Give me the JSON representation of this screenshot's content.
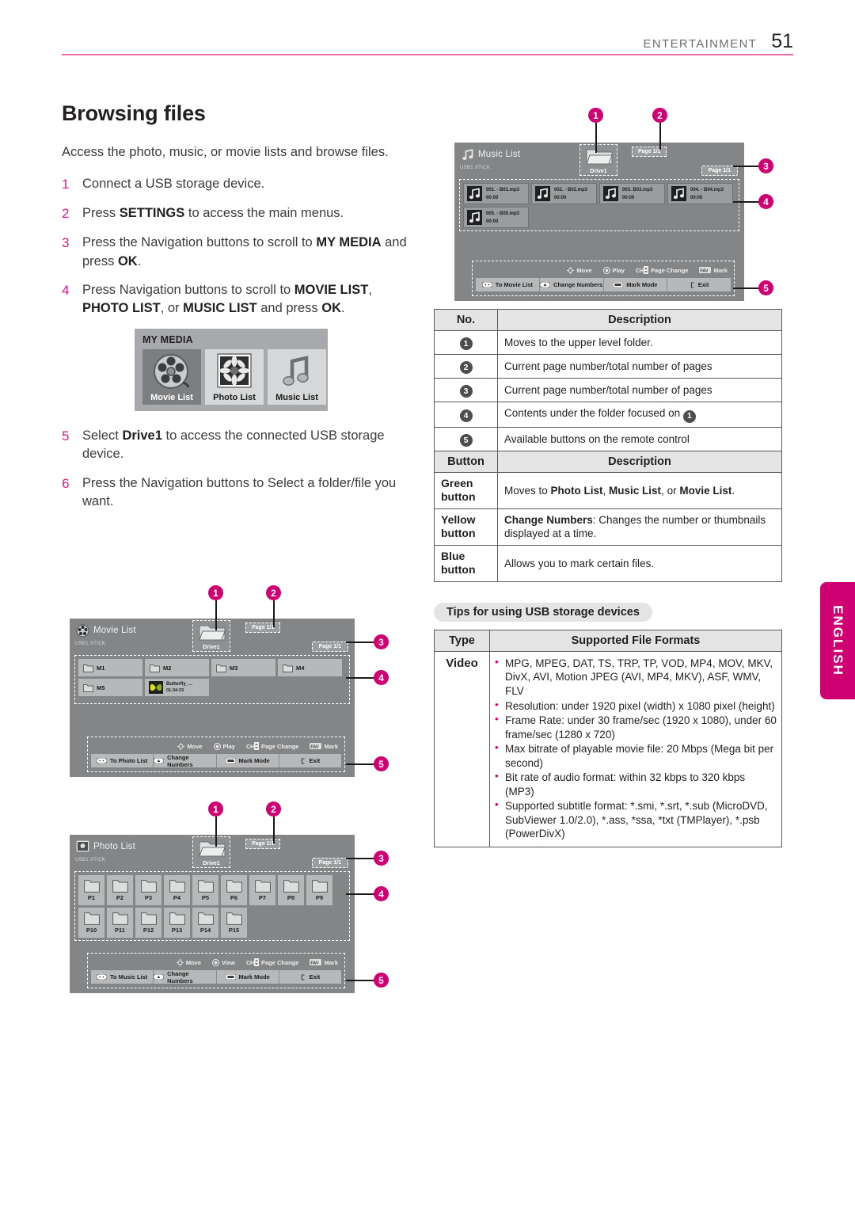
{
  "header": {
    "chapter": "ENTERTAINMENT",
    "page_number": "51"
  },
  "section": {
    "title": "Browsing files",
    "lede": "Access the photo, music, or movie lists and browse files.",
    "steps": [
      {
        "num": "1",
        "html": "Connect a USB storage device."
      },
      {
        "num": "2",
        "html": "Press <b>SETTINGS</b> to access the main menus."
      },
      {
        "num": "3",
        "html": "Press the Navigation buttons to scroll to <b>MY MEDIA</b> and press <b>OK</b>."
      },
      {
        "num": "4",
        "html": "Press Navigation buttons to scroll to <b>MOVIE LIST</b>, <b>PHOTO LIST</b>, or <b>MUSIC LIST</b> and press <b>OK</b>."
      },
      {
        "num": "5",
        "html": "Select <b>Drive1</b> to access the connected USB storage device."
      },
      {
        "num": "6",
        "html": "Press the Navigation buttons to Select a folder/file you want."
      }
    ]
  },
  "mymedia": {
    "title": "MY MEDIA",
    "tiles": [
      {
        "label": "Movie List",
        "icon": "film-reel-icon",
        "selected": true
      },
      {
        "label": "Photo List",
        "icon": "flower-photo-icon",
        "selected": false
      },
      {
        "label": "Music List",
        "icon": "music-note-icon",
        "selected": false
      }
    ]
  },
  "callouts": [
    "1",
    "2",
    "3",
    "4",
    "5"
  ],
  "screens": {
    "movie_list": {
      "title": "Movie List",
      "device": "USB1 XTICK",
      "drive_label": "Drive1",
      "page_top": "Page 1/1",
      "page_right": "Page 1/1",
      "items": [
        {
          "label": "M1",
          "type": "folder"
        },
        {
          "label": "M2",
          "type": "folder"
        },
        {
          "label": "M3",
          "type": "folder"
        },
        {
          "label": "M4",
          "type": "folder"
        },
        {
          "label": "M5",
          "type": "folder"
        },
        {
          "label": "Butterfly_...",
          "time": "01:34:33",
          "type": "thumb"
        }
      ],
      "hints": [
        {
          "icon": "dpad-icon",
          "label": "Move"
        },
        {
          "icon": "ok-icon",
          "label": "Play"
        },
        {
          "icon": "ch-updown-icon",
          "label": "Page Change"
        },
        {
          "icon": "fav-icon",
          "label": "Mark"
        }
      ],
      "buttons": [
        {
          "icon": "green-key-icon",
          "label": "To Photo List"
        },
        {
          "icon": "yellow-key-icon",
          "label": "Change Numbers"
        },
        {
          "icon": "blue-key-icon",
          "label": "Mark Mode"
        },
        {
          "icon": "exit-key-icon",
          "label": "Exit"
        }
      ]
    },
    "photo_list": {
      "title": "Photo List",
      "device": "USB1 XTICK",
      "drive_label": "Drive1",
      "page_top": "Page 1/1",
      "page_right": "Page 1/1",
      "items": [
        {
          "label": "P1"
        },
        {
          "label": "P2"
        },
        {
          "label": "P3"
        },
        {
          "label": "P4"
        },
        {
          "label": "P5"
        },
        {
          "label": "P6"
        },
        {
          "label": "P7"
        },
        {
          "label": "P8"
        },
        {
          "label": "P9"
        },
        {
          "label": "P10"
        },
        {
          "label": "P11"
        },
        {
          "label": "P12"
        },
        {
          "label": "P13"
        },
        {
          "label": "P14"
        },
        {
          "label": "P15"
        }
      ],
      "hints": [
        {
          "icon": "dpad-icon",
          "label": "Move"
        },
        {
          "icon": "ok-icon",
          "label": "View"
        },
        {
          "icon": "ch-updown-icon",
          "label": "Page Change"
        },
        {
          "icon": "fav-icon",
          "label": "Mark"
        }
      ],
      "buttons": [
        {
          "icon": "green-key-icon",
          "label": "To Music List"
        },
        {
          "icon": "yellow-key-icon",
          "label": "Change Numbers"
        },
        {
          "icon": "blue-key-icon",
          "label": "Mark Mode"
        },
        {
          "icon": "exit-key-icon",
          "label": "Exit"
        }
      ]
    },
    "music_list": {
      "title": "Music List",
      "device": "USB1 XTICK",
      "drive_label": "Drive1",
      "page_top": "Page 1/1",
      "page_right": "Page 1/1",
      "items": [
        {
          "name": "001. - B01.mp3",
          "time": "00:00"
        },
        {
          "name": "002. - B02.mp3",
          "time": "00:00"
        },
        {
          "name": "003. B03.mp3",
          "time": "00:00"
        },
        {
          "name": "004. - B04.mp3",
          "time": "00:00"
        },
        {
          "name": "005. - B05.mp3",
          "time": "00:00"
        }
      ],
      "hints": [
        {
          "icon": "dpad-icon",
          "label": "Move"
        },
        {
          "icon": "ok-icon",
          "label": "Play"
        },
        {
          "icon": "ch-updown-icon",
          "label": "Page Change"
        },
        {
          "icon": "fav-icon",
          "label": "Mark"
        }
      ],
      "buttons": [
        {
          "icon": "green-key-icon",
          "label": "To Movie List"
        },
        {
          "icon": "yellow-key-icon",
          "label": "Change Numbers"
        },
        {
          "icon": "blue-key-icon",
          "label": "Mark Mode"
        },
        {
          "icon": "exit-key-icon",
          "label": "Exit"
        }
      ]
    }
  },
  "no_table": {
    "headers": [
      "No.",
      "Description"
    ],
    "rows": [
      {
        "no": "1",
        "desc": "Moves to the upper level folder."
      },
      {
        "no": "2",
        "desc": "Current page number/total number of pages"
      },
      {
        "no": "3",
        "desc": "Current page number/total number of pages"
      },
      {
        "no": "4",
        "desc": "Contents under the folder focused on",
        "trailing_badge": "1"
      },
      {
        "no": "5",
        "desc": "Available buttons on the remote control"
      }
    ]
  },
  "button_table": {
    "headers": [
      "Button",
      "Description"
    ],
    "rows": [
      {
        "button": "Green button",
        "desc_html": "Moves to <b>Photo List</b>, <b>Music List</b>, or <b>Movie List</b>."
      },
      {
        "button": "Yellow button",
        "desc_html": "<b>Change Numbers</b>: Changes the number or thumbnails displayed at a time."
      },
      {
        "button": "Blue button",
        "desc_html": "Allows you to mark certain files."
      }
    ]
  },
  "tips": {
    "pill": "Tips for using USB storage devices",
    "headers": [
      "Type",
      "Supported File Formats"
    ],
    "rows": [
      {
        "type": "Video",
        "bullets": [
          "MPG, MPEG, DAT, TS, TRP, TP, VOD, MP4, MOV, MKV, DivX, AVI, Motion JPEG (AVI, MP4, MKV), ASF, WMV, FLV",
          "Resolution: under 1920 pixel (width) x 1080 pixel (height)",
          "Frame Rate: under 30 frame/sec (1920 x 1080), under 60 frame/sec (1280 x 720)",
          "Max bitrate of playable movie file: 20 Mbps (Mega bit per second)",
          "Bit rate of audio format: within 32 kbps to 320 kbps (MP3)",
          "Supported subtitle format: *.smi, *.srt, *.sub (MicroDVD, SubViewer 1.0/2.0), *.ass, *ssa, *txt (TMPlayer), *.psb (PowerDivX)"
        ]
      }
    ]
  },
  "lang_tab": {
    "label": "ENGLISH"
  },
  "colors": {
    "accent": "#cf0072",
    "rule": "#ef6ba8",
    "tv_bg": "#838587",
    "tv_cell": "#b6b8ba"
  }
}
